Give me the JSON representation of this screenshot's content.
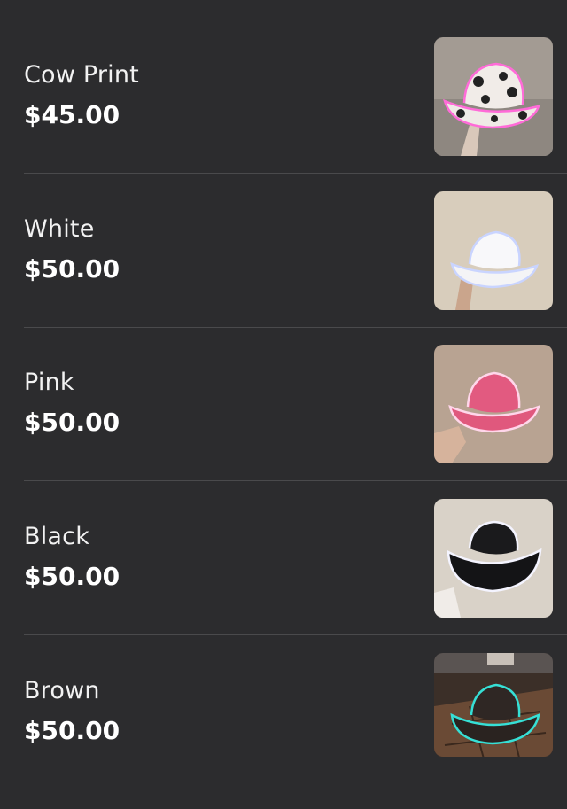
{
  "products": [
    {
      "name": "Cow Print",
      "price": "$45.00",
      "thumbnail": "cow-print-light-up-cowboy-hat"
    },
    {
      "name": "White",
      "price": "$50.00",
      "thumbnail": "white-light-up-cowboy-hat"
    },
    {
      "name": "Pink",
      "price": "$50.00",
      "thumbnail": "pink-light-up-cowboy-hat"
    },
    {
      "name": "Black",
      "price": "$50.00",
      "thumbnail": "black-light-up-cowboy-hat"
    },
    {
      "name": "Brown",
      "price": "$50.00",
      "thumbnail": "brown-light-up-cowboy-hat"
    }
  ],
  "colors": {
    "background": "#2c2c2e",
    "divider": "#4a4a4c",
    "text": "#ffffff"
  }
}
